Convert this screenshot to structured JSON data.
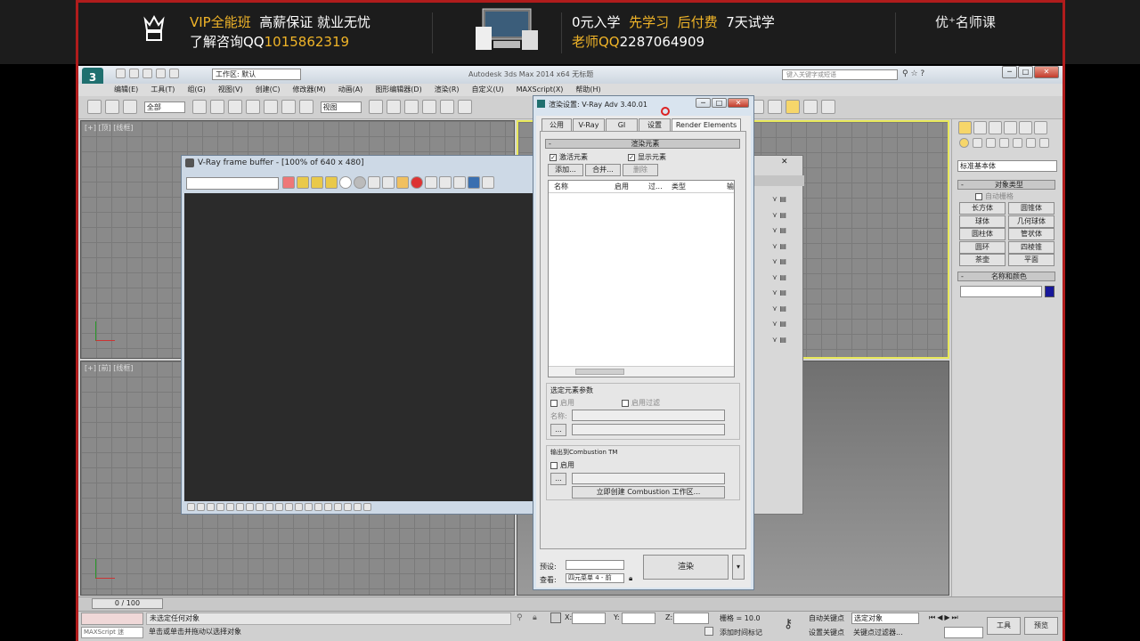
{
  "banner": {
    "vip_label": "VIP全能班",
    "vip_slogan": "高薪保证 就业无忧",
    "consult_label": "了解咨询QQ",
    "consult_qq": "1015862319",
    "promo_free": "0元入学",
    "promo_learn": "先学习",
    "promo_pay": "后付费",
    "promo_trial": "7天试学",
    "teacher_label": "老师QQ",
    "teacher_qq": "2287064909",
    "brand": "优⁺名师课"
  },
  "app": {
    "title": "Autodesk 3ds Max  2014 x64      无标题",
    "workspace": "工作区: 默认",
    "search_placeholder": "键入关键字或短语"
  },
  "menu": [
    "编辑(E)",
    "工具(T)",
    "组(G)",
    "视图(V)",
    "创建(C)",
    "修改器(M)",
    "动画(A)",
    "图形编辑器(D)",
    "渲染(R)",
    "自定义(U)",
    "MAXScript(X)",
    "帮助(H)"
  ],
  "toolbar": {
    "selection_filter": "全部",
    "view_dropdown": "视图"
  },
  "viewports": {
    "top_left": "[+] [顶] [线框]",
    "front_left": "[+] [前] [线框]"
  },
  "timeline": {
    "frame": "0 / 100"
  },
  "vfb": {
    "title": "V-Ray frame buffer - [100% of 640 x 480]"
  },
  "render_dialog": {
    "title": "渲染设置: V-Ray Adv 3.40.01",
    "tabs": [
      "公用",
      "V-Ray",
      "GI",
      "设置",
      "Render Elements"
    ],
    "section_title": "渲染元素",
    "activate_elements": "激活元素",
    "display_elements": "显示元素",
    "add_button": "添加...",
    "merge_button": "合并...",
    "delete_button": "删除",
    "columns": [
      "名称",
      "启用",
      "过...",
      "类型",
      "输"
    ],
    "selected_params_title": "选定元素参数",
    "enable": "启用",
    "enable_filter": "启用过滤",
    "name_label": "名称:",
    "browse": "...",
    "combustion_title": "输出到Combustion  TM",
    "combustion_enable": "启用",
    "create_combustion": "立即创建 Combustion 工作区...",
    "preset_label": "预设:",
    "view_label": "查看:",
    "view_value": "四元菜单 4 - 前",
    "render_button": "渲染"
  },
  "command_panel": {
    "category": "标准基本体",
    "object_type_title": "对象类型",
    "autogrid": "自动栅格",
    "buttons": [
      "长方体",
      "圆锥体",
      "球体",
      "几何球体",
      "圆柱体",
      "管状体",
      "圆环",
      "四棱锥",
      "茶壶",
      "平面"
    ],
    "name_color_title": "名称和颜色"
  },
  "status": {
    "maxscript": "MAXScript 迷",
    "selection": "未选定任何对象",
    "prompt": "单击或单击并拖动以选择对象",
    "x_label": "X:",
    "y_label": "Y:",
    "z_label": "Z:",
    "grid": "栅格 = 10.0",
    "add_time_tag": "添加时间标记",
    "auto_key": "自动关键点",
    "set_key": "设置关键点",
    "selected_object": "选定对象",
    "key_filter": "关键点过滤器...",
    "tools": "工具",
    "preview": "预览"
  }
}
